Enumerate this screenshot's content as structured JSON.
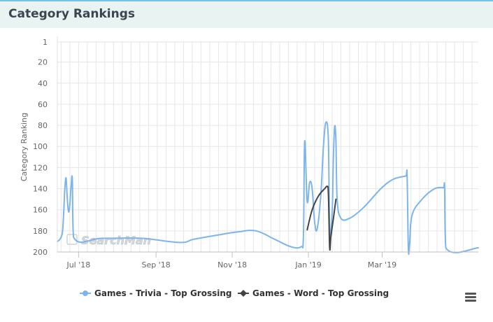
{
  "header": {
    "title": "Category Rankings"
  },
  "colors": {
    "trivia": "#7cb5ec",
    "word": "#434348",
    "grid": "#e6e6e6",
    "header_bg": "#e9f3f1",
    "accent": "#79bfe6"
  },
  "watermark": "SearchMan",
  "icons": {
    "menu": "hamburger-menu-icon"
  },
  "chart_data": {
    "type": "line",
    "title": "",
    "ylabel": "Category Ranking",
    "xlabel": "",
    "y_reversed": true,
    "ylim": [
      1,
      200
    ],
    "yticks": [
      1,
      20,
      40,
      60,
      80,
      100,
      120,
      140,
      160,
      180,
      200
    ],
    "xlim": [
      "2018-06-14",
      "2019-05-17"
    ],
    "xticks": [
      {
        "date": "2018-07-01",
        "label": "Jul '18"
      },
      {
        "date": "2018-09-01",
        "label": "Sep '18"
      },
      {
        "date": "2018-11-01",
        "label": "Nov '18"
      },
      {
        "date": "2019-01-01",
        "label": "Jan '19"
      },
      {
        "date": "2019-03-01",
        "label": "Mar '19"
      }
    ],
    "grid": true,
    "legend_position": "bottom-center",
    "series": [
      {
        "name": "Games - Trivia - Top Grossing",
        "color": "#7cb5ec",
        "marker": "circle",
        "points": [
          [
            "2018-06-14",
            190
          ],
          [
            "2018-06-16",
            188
          ],
          [
            "2018-06-18",
            182
          ],
          [
            "2018-06-19",
            165
          ],
          [
            "2018-06-20",
            140
          ],
          [
            "2018-06-21",
            130
          ],
          [
            "2018-06-22",
            150
          ],
          [
            "2018-06-23",
            162
          ],
          [
            "2018-06-24",
            155
          ],
          [
            "2018-06-25",
            138
          ],
          [
            "2018-06-26",
            131
          ],
          [
            "2018-06-27",
            186
          ],
          [
            "2018-07-20",
            187
          ],
          [
            "2018-08-20",
            187
          ],
          [
            "2018-09-20",
            191
          ],
          [
            "2018-10-01",
            188
          ],
          [
            "2018-10-20",
            184
          ],
          [
            "2018-11-05",
            181
          ],
          [
            "2018-11-20",
            180
          ],
          [
            "2018-12-05",
            188
          ],
          [
            "2018-12-18",
            195
          ],
          [
            "2018-12-26",
            195
          ],
          [
            "2018-12-28",
            185
          ],
          [
            "2018-12-29",
            95
          ],
          [
            "2018-12-31",
            152
          ],
          [
            "2019-01-02",
            134
          ],
          [
            "2019-01-04",
            140
          ],
          [
            "2019-01-06",
            172
          ],
          [
            "2019-01-08",
            178
          ],
          [
            "2019-01-11",
            145
          ],
          [
            "2019-01-13",
            100
          ],
          [
            "2019-01-15",
            77
          ],
          [
            "2019-01-17",
            95
          ],
          [
            "2019-01-18",
            180
          ],
          [
            "2019-01-20",
            162
          ],
          [
            "2019-01-21",
            110
          ],
          [
            "2019-01-22",
            81
          ],
          [
            "2019-01-23",
            95
          ],
          [
            "2019-01-24",
            150
          ],
          [
            "2019-01-27",
            168
          ],
          [
            "2019-02-03",
            168
          ],
          [
            "2019-02-14",
            158
          ],
          [
            "2019-02-28",
            140
          ],
          [
            "2019-03-10",
            131
          ],
          [
            "2019-03-20",
            128
          ],
          [
            "2019-03-21",
            128
          ],
          [
            "2019-03-22",
            197
          ],
          [
            "2019-03-23",
            192
          ],
          [
            "2019-03-25",
            165
          ],
          [
            "2019-04-02",
            150
          ],
          [
            "2019-04-12",
            140
          ],
          [
            "2019-04-19",
            139
          ],
          [
            "2019-04-20",
            139
          ],
          [
            "2019-04-21",
            196
          ],
          [
            "2019-05-17",
            196
          ]
        ]
      },
      {
        "name": "Games - Word - Top Grossing",
        "color": "#434348",
        "marker": "diamond",
        "points": [
          [
            "2018-12-31",
            179
          ],
          [
            "2019-01-04",
            160
          ],
          [
            "2019-01-09",
            147
          ],
          [
            "2019-01-14",
            140
          ],
          [
            "2019-01-16",
            138
          ],
          [
            "2019-01-17",
            145
          ],
          [
            "2019-01-18",
            196
          ],
          [
            "2019-01-19",
            185
          ],
          [
            "2019-01-21",
            168
          ],
          [
            "2019-01-23",
            150
          ]
        ]
      }
    ]
  }
}
